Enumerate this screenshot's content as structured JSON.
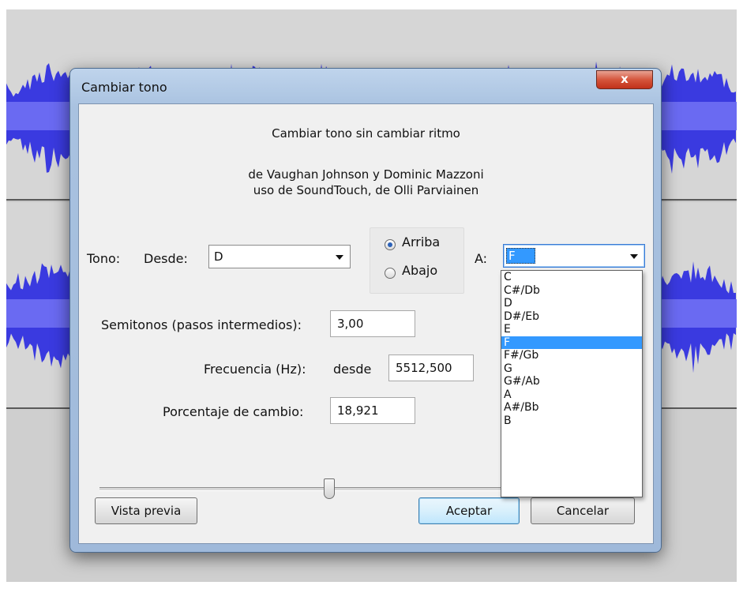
{
  "dialog": {
    "title": "Cambiar tono",
    "close_label": "x",
    "header_line1": "Cambiar tono sin cambiar ritmo",
    "header_line2": "de Vaughan Johnson y Dominic Mazzoni",
    "header_line3": "uso de SoundTouch, de Olli Parviainen"
  },
  "pitch": {
    "tono_label": "Tono:",
    "desde_label": "Desde:",
    "from_value": "D",
    "up_label": "Arriba",
    "down_label": "Abajo",
    "direction_selected": "Arriba",
    "to_label": "A:",
    "to_value": "F"
  },
  "fields": {
    "semitones_label": "Semitonos (pasos intermedios):",
    "semitones_value": "3,00",
    "frequency_label": "Frecuencia (Hz):",
    "frequency_from_label": "desde",
    "frequency_from_value": "5512,500",
    "percent_label": "Porcentaje de cambio:",
    "percent_value": "18,921"
  },
  "slider": {
    "level_fraction": 0.56
  },
  "buttons": {
    "preview": "Vista previa",
    "ok": "Aceptar",
    "cancel": "Cancelar"
  },
  "dropdown": {
    "items": [
      "C",
      "C#/Db",
      "D",
      "D#/Eb",
      "E",
      "F",
      "F#/Gb",
      "G",
      "G#/Ab",
      "A",
      "A#/Bb",
      "B"
    ],
    "selected": "F"
  },
  "colors": {
    "waveform": "#3a3ae0",
    "selection": "#3399ff",
    "window_frame": "#a9c2e0",
    "close_button": "#c1311a"
  }
}
